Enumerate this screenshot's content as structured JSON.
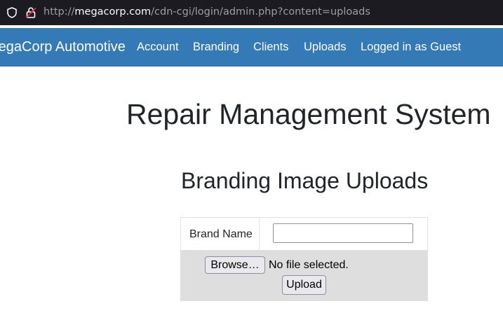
{
  "browser": {
    "url_prefix": "http://",
    "url_host": "megacorp.com",
    "url_path": "/cdn-cgi/login/admin.php?content=uploads",
    "icons": [
      "shield-icon",
      "insecure-lock-icon"
    ]
  },
  "navbar": {
    "brand": "MegaCorp Automotive",
    "links": [
      "Account",
      "Branding",
      "Clients",
      "Uploads",
      "Logged in as Guest"
    ],
    "background_color": "#337ab7"
  },
  "main": {
    "title": "Repair Management System",
    "section_title": "Branding Image Uploads",
    "form": {
      "brand_name_label": "Brand Name",
      "brand_name_value": "",
      "browse_label": "Browse…",
      "no_file_text": "No file selected.",
      "upload_label": "Upload"
    }
  }
}
